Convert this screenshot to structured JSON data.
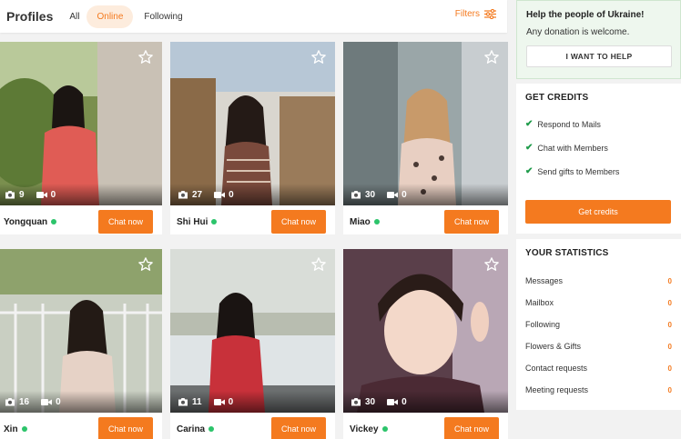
{
  "header": {
    "title": "Profiles",
    "tabs": [
      {
        "label": "All",
        "active": false
      },
      {
        "label": "Online",
        "active": true
      },
      {
        "label": "Following",
        "active": false
      }
    ],
    "filters_label": "Filters"
  },
  "profiles": [
    {
      "name": "Yongquan",
      "photos": "9",
      "videos": "0",
      "online": true,
      "chat_label": "Chat now"
    },
    {
      "name": "Shi Hui",
      "photos": "27",
      "videos": "0",
      "online": true,
      "chat_label": "Chat now"
    },
    {
      "name": "Miao",
      "photos": "30",
      "videos": "0",
      "online": true,
      "chat_label": "Chat now"
    },
    {
      "name": "Xin",
      "photos": "16",
      "videos": "0",
      "online": true,
      "chat_label": "Chat now"
    },
    {
      "name": "Carina",
      "photos": "11",
      "videos": "0",
      "online": true,
      "chat_label": "Chat now"
    },
    {
      "name": "Vickey",
      "photos": "30",
      "videos": "0",
      "online": true,
      "chat_label": "Chat now"
    }
  ],
  "ukraine": {
    "heading": "Help the people of Ukraine!",
    "text": "Any donation is welcome.",
    "button": "I WANT TO HELP"
  },
  "credits": {
    "title": "GET CREDITS",
    "items": [
      "Respond to Mails",
      "Chat with Members",
      "Send gifts to Members"
    ],
    "button": "Get credits"
  },
  "statistics": {
    "title": "YOUR STATISTICS",
    "rows": [
      {
        "label": "Messages",
        "value": "0"
      },
      {
        "label": "Mailbox",
        "value": "0"
      },
      {
        "label": "Following",
        "value": "0"
      },
      {
        "label": "Flowers & Gifts",
        "value": "0"
      },
      {
        "label": "Contact requests",
        "value": "0"
      },
      {
        "label": "Meeting requests",
        "value": "0"
      }
    ]
  },
  "colors": {
    "accent": "#f47a1f",
    "online": "#2cc46b",
    "check": "#1e9b4a"
  }
}
